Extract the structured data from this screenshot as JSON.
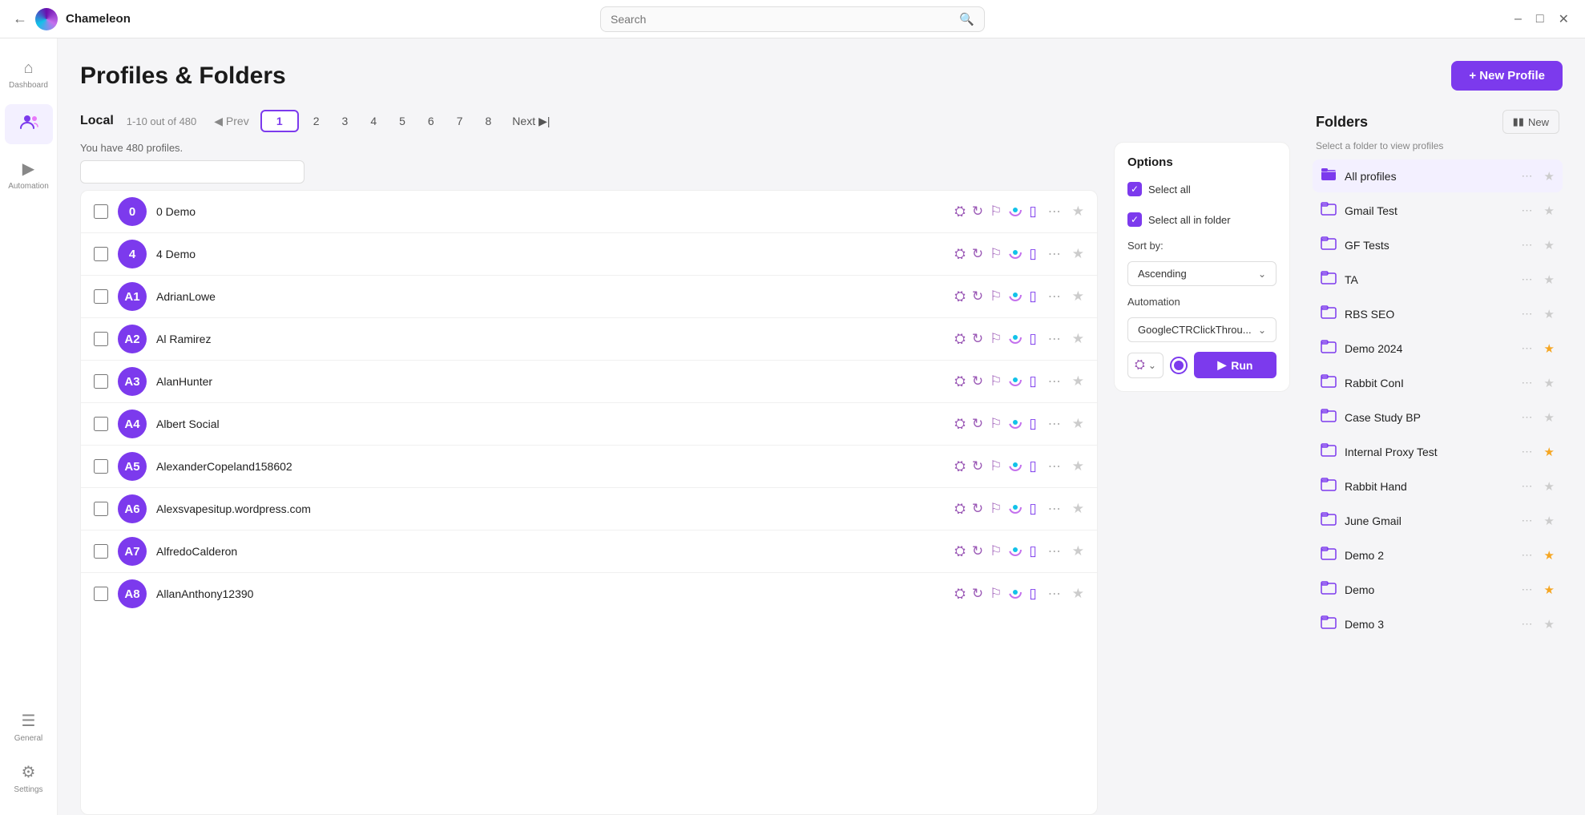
{
  "titleBar": {
    "appName": "Chameleon",
    "searchPlaceholder": "Search",
    "winButtons": [
      "minimize",
      "maximize",
      "close"
    ]
  },
  "sidebar": {
    "items": [
      {
        "id": "dashboard",
        "label": "Dashboard",
        "icon": "⊞",
        "active": false
      },
      {
        "id": "profiles",
        "label": "",
        "icon": "👤",
        "active": true
      },
      {
        "id": "automation",
        "label": "Automation",
        "icon": "▶",
        "active": false
      }
    ],
    "bottomItems": [
      {
        "id": "general",
        "label": "General",
        "icon": "≡"
      },
      {
        "id": "settings",
        "label": "Settings",
        "icon": "⚙"
      }
    ]
  },
  "pageTitle": "Profiles & Folders",
  "newProfileButton": "+ New Profile",
  "pagination": {
    "localLabel": "Local",
    "countLabel": "1-10 out of 480",
    "prevLabel": "Prev",
    "currentPage": "1",
    "pages": [
      "2",
      "3",
      "4",
      "5",
      "6",
      "7",
      "8"
    ],
    "nextLabel": "Next"
  },
  "profilesCount": "You have 480 profiles.",
  "profiles": [
    {
      "id": "0",
      "name": "0 Demo",
      "avatarColor": "#7c3aed",
      "starred": false
    },
    {
      "id": "4",
      "name": "4 Demo",
      "avatarColor": "#7c3aed",
      "starred": false
    },
    {
      "id": "A1",
      "name": "AdrianLowe",
      "avatarColor": "#7c3aed",
      "starred": false
    },
    {
      "id": "A2",
      "name": "Al Ramirez",
      "avatarColor": "#7c3aed",
      "starred": false
    },
    {
      "id": "A3",
      "name": "AlanHunter",
      "avatarColor": "#7c3aed",
      "starred": false
    },
    {
      "id": "A4",
      "name": "Albert Social",
      "avatarColor": "#7c3aed",
      "starred": false
    },
    {
      "id": "A5",
      "name": "AlexanderCopeland158602",
      "avatarColor": "#7c3aed",
      "starred": false
    },
    {
      "id": "A6",
      "name": "Alexsvapesitup.wordpress.com",
      "avatarColor": "#7c3aed",
      "starred": false
    },
    {
      "id": "A7",
      "name": "AlfredoCalderon",
      "avatarColor": "#7c3aed",
      "starred": false
    },
    {
      "id": "A8",
      "name": "AllanAnthony12390",
      "avatarColor": "#7c3aed",
      "starred": false
    }
  ],
  "options": {
    "title": "Options",
    "selectAll": "Select all",
    "selectAllInFolder": "Select all in folder",
    "sortByLabel": "Sort by:",
    "sortByValue": "Ascending",
    "automationLabel": "Automation",
    "automationValue": "GoogleCTRClickThrou...",
    "runButton": "Run"
  },
  "folders": {
    "title": "Folders",
    "newLabel": "New",
    "hint": "Select a folder to view profiles",
    "items": [
      {
        "name": "All profiles",
        "filled": true,
        "starred": false,
        "active": true
      },
      {
        "name": "Gmail Test",
        "filled": false,
        "starred": false,
        "active": false
      },
      {
        "name": "GF Tests",
        "filled": false,
        "starred": false,
        "active": false
      },
      {
        "name": "TA",
        "filled": false,
        "starred": false,
        "active": false
      },
      {
        "name": "RBS SEO",
        "filled": false,
        "starred": false,
        "active": false
      },
      {
        "name": "Demo 2024",
        "filled": false,
        "starred": true,
        "active": false
      },
      {
        "name": "Rabbit ConI",
        "filled": false,
        "starred": false,
        "active": false
      },
      {
        "name": "Case Study BP",
        "filled": false,
        "starred": false,
        "active": false
      },
      {
        "name": "Internal Proxy Test",
        "filled": false,
        "starred": true,
        "active": false
      },
      {
        "name": "Rabbit Hand",
        "filled": false,
        "starred": false,
        "active": false
      },
      {
        "name": "June Gmail",
        "filled": false,
        "starred": false,
        "active": false
      },
      {
        "name": "Demo 2",
        "filled": false,
        "starred": true,
        "active": false
      },
      {
        "name": "Demo",
        "filled": false,
        "starred": true,
        "active": false
      },
      {
        "name": "Demo 3",
        "filled": false,
        "starred": false,
        "active": false
      }
    ]
  }
}
